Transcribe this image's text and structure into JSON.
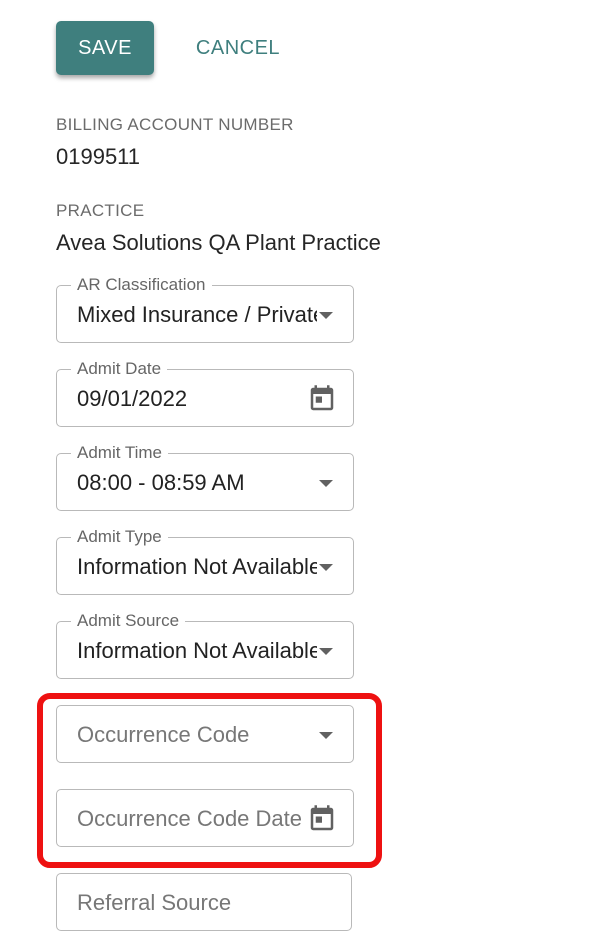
{
  "actions": {
    "save_label": "SAVE",
    "cancel_label": "CANCEL"
  },
  "billing_account": {
    "label": "BILLING ACCOUNT NUMBER",
    "value": "0199511"
  },
  "practice": {
    "label": "PRACTICE",
    "value": "Avea Solutions QA Plant Practice"
  },
  "fields": {
    "ar_classification": {
      "label": "AR Classification",
      "value": "Mixed Insurance / Private Pay",
      "icon": "chevron-down-icon"
    },
    "admit_date": {
      "label": "Admit Date",
      "value": "09/01/2022",
      "icon": "calendar-icon"
    },
    "admit_time": {
      "label": "Admit Time",
      "value": "08:00 - 08:59 AM",
      "icon": "chevron-down-icon"
    },
    "admit_type": {
      "label": "Admit Type",
      "value": "Information Not Available",
      "icon": "chevron-down-icon"
    },
    "admit_source": {
      "label": "Admit Source",
      "value": "Information Not Available",
      "icon": "chevron-down-icon"
    },
    "occurrence_code": {
      "placeholder": "Occurrence Code",
      "icon": "chevron-down-icon"
    },
    "occurrence_code_date": {
      "placeholder": "Occurrence Code Date",
      "icon": "calendar-icon"
    },
    "referral_source": {
      "placeholder": "Referral Source"
    }
  },
  "colors": {
    "primary": "#3f7f7e",
    "highlight": "#ee1111",
    "border": "#b9b9b9"
  }
}
